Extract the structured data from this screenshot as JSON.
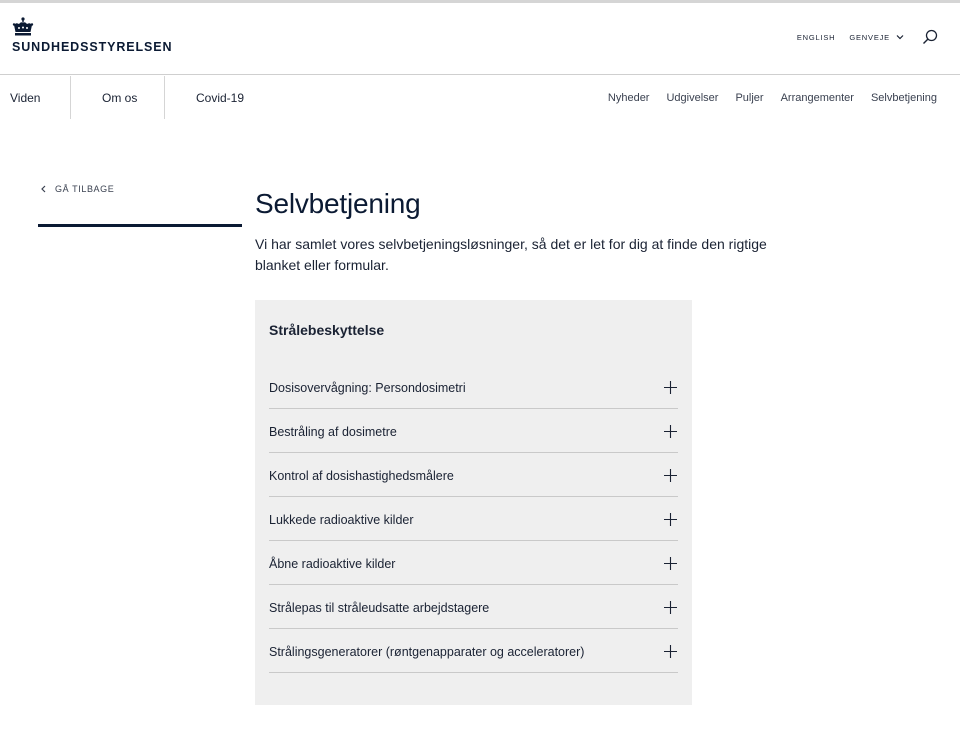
{
  "header": {
    "logo_text": "SUNDHEDSSTYRELSEN",
    "english_label": "ENGLISH",
    "genveje_label": "GENVEJE"
  },
  "nav": {
    "main": [
      "Viden",
      "Om os",
      "Covid-19"
    ],
    "right": [
      "Nyheder",
      "Udgivelser",
      "Puljer",
      "Arrangementer",
      "Selvbetjening"
    ]
  },
  "back_label": "GÅ TILBAGE",
  "page": {
    "title": "Selvbetjening",
    "lead": "Vi har samlet vores selvbetjeningsløsninger, så det er let for dig at finde den rigtige blanket eller formular."
  },
  "panel": {
    "title": "Strålebeskyttelse",
    "items": [
      "Dosisovervågning: Persondosimetri",
      "Bestråling af dosimetre",
      "Kontrol af dosishastighedsmålere",
      "Lukkede radioaktive kilder",
      "Åbne radioaktive kilder",
      "Strålepas til stråleudsatte arbejdstagere",
      "Strålingsgeneratorer (røntgenapparater og acceleratorer)"
    ]
  },
  "colors": {
    "brand_navy": "#0b1a33",
    "panel_bg": "#efefef",
    "divider": "#c9c9c9"
  },
  "icons": {
    "logo": "crown-icon",
    "search": "search-icon",
    "dropdown": "chevron-down-icon",
    "back": "chevron-left-icon",
    "expand": "plus-icon"
  }
}
